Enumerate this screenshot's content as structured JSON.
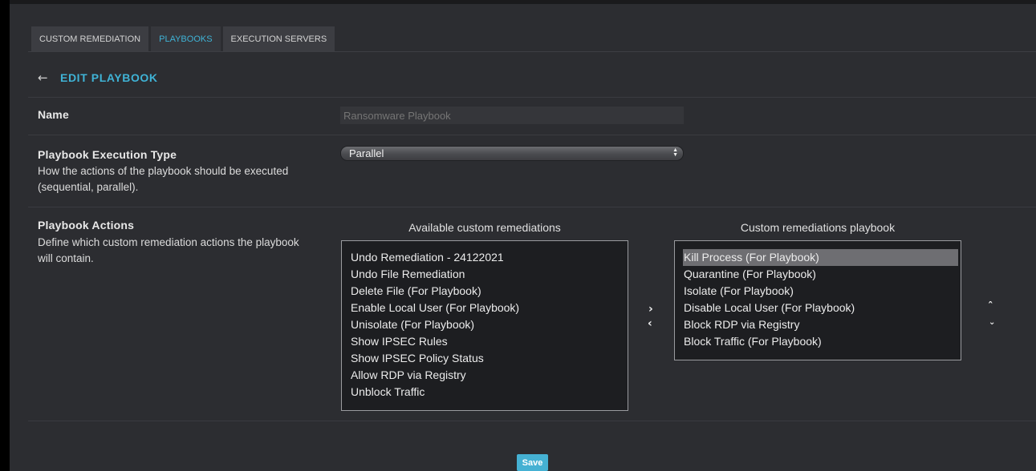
{
  "tabs": [
    {
      "label": "CUSTOM REMEDIATION",
      "active": false
    },
    {
      "label": "PLAYBOOKS",
      "active": true
    },
    {
      "label": "EXECUTION SERVERS",
      "active": false
    }
  ],
  "header": {
    "back_icon": "arrow-left-icon",
    "title": "EDIT PLAYBOOK"
  },
  "name_row": {
    "label": "Name",
    "value": "",
    "placeholder": "Ransomware Playbook"
  },
  "execution_row": {
    "label": "Playbook Execution Type",
    "description": "How the actions of the playbook should be executed (sequential, parallel).",
    "selected": "Parallel"
  },
  "actions_row": {
    "label": "Playbook Actions",
    "description": "Define which custom remediation actions the playbook will contain.",
    "available_heading": "Available custom remediations",
    "available_items": [
      "Undo Remediation - 24122021",
      "Undo File Remediation",
      "Delete File (For Playbook)",
      "Enable Local User (For Playbook)",
      "Unisolate (For Playbook)",
      "Show IPSEC Rules",
      "Show IPSEC Policy Status",
      "Allow RDP via Registry",
      "Unblock Traffic"
    ],
    "playbook_heading": "Custom remediations playbook",
    "playbook_items": [
      "Kill Process (For Playbook)",
      "Quarantine (For Playbook)",
      "Isolate (For Playbook)",
      "Disable Local User (For Playbook)",
      "Block RDP via Registry",
      "Block Traffic (For Playbook)"
    ],
    "playbook_selected_index": 0
  },
  "save_label": "Save",
  "colors": {
    "accent": "#3fb3d6",
    "background": "#2c2d31",
    "save": "#45b1d3"
  }
}
